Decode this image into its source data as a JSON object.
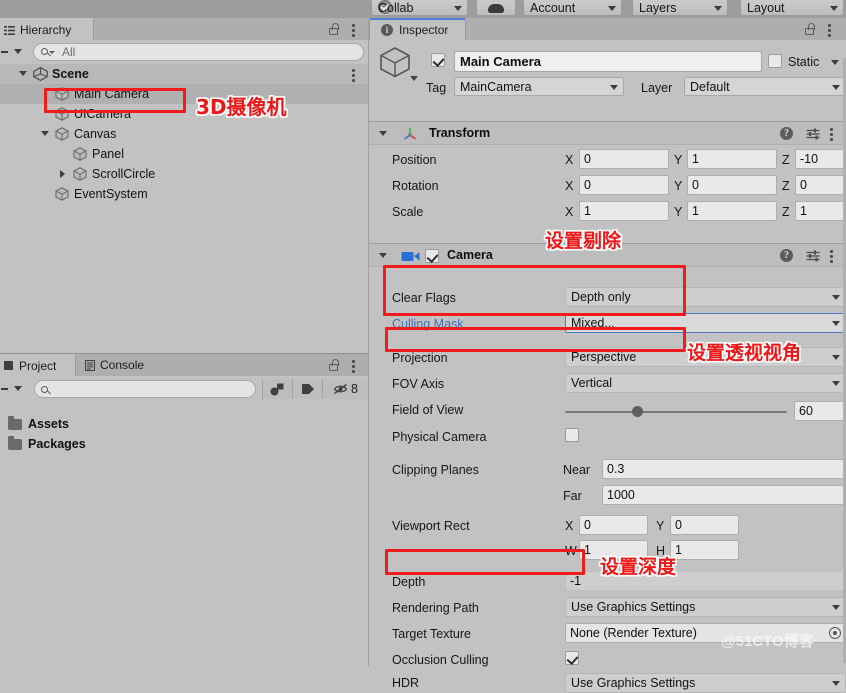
{
  "toolbar": {
    "collab_label": "Collab",
    "cloud_label": "",
    "account_label": "Account",
    "layers_label": "Layers",
    "layout_label": "Layout"
  },
  "hierarchy": {
    "tab_label": "Hierarchy",
    "search_placeholder": "All",
    "items": [
      {
        "label": "Scene",
        "depth": 0,
        "twisty": "open",
        "icon": "unity-scene-icon"
      },
      {
        "label": "Main Camera",
        "depth": 1,
        "twisty": "none",
        "icon": "gameobject-cube-icon"
      },
      {
        "label": "UICamera",
        "depth": 1,
        "twisty": "none",
        "icon": "gameobject-cube-icon"
      },
      {
        "label": "Canvas",
        "depth": 1,
        "twisty": "open",
        "icon": "gameobject-cube-icon"
      },
      {
        "label": "Panel",
        "depth": 2,
        "twisty": "none",
        "icon": "gameobject-cube-icon"
      },
      {
        "label": "ScrollCircle",
        "depth": 2,
        "twisty": "closed",
        "icon": "gameobject-cube-icon"
      },
      {
        "label": "EventSystem",
        "depth": 1,
        "twisty": "none",
        "icon": "gameobject-cube-icon"
      }
    ]
  },
  "project": {
    "tab_label": "Project",
    "console_tab_label": "Console",
    "search_placeholder": "",
    "hidden_count": "8",
    "items": [
      {
        "label": "Assets"
      },
      {
        "label": "Packages"
      }
    ]
  },
  "inspector": {
    "tab_label": "Inspector",
    "object_name": "Main Camera",
    "object_enabled": true,
    "static_label": "Static",
    "static_checked": false,
    "tag_label": "Tag",
    "tag_value": "MainCamera",
    "layer_label": "Layer",
    "layer_value": "Default",
    "transform": {
      "title": "Transform",
      "rows": [
        {
          "label": "Position",
          "x": "0",
          "y": "1",
          "z": "-10"
        },
        {
          "label": "Rotation",
          "x": "0",
          "y": "0",
          "z": "0"
        },
        {
          "label": "Scale",
          "x": "1",
          "y": "1",
          "z": "1"
        }
      ],
      "axis_x": "X",
      "axis_y": "Y",
      "axis_z": "Z"
    },
    "camera": {
      "title": "Camera",
      "enabled": true,
      "clear_flags_label": "Clear Flags",
      "clear_flags_value": "Depth only",
      "culling_mask_label": "Culling Mask",
      "culling_mask_value": "Mixed...",
      "projection_label": "Projection",
      "projection_value": "Perspective",
      "fov_axis_label": "FOV Axis",
      "fov_axis_value": "Vertical",
      "field_of_view_label": "Field of View",
      "field_of_view_value": "60",
      "field_of_view_slider_pct": 30,
      "physical_camera_label": "Physical Camera",
      "physical_camera_checked": false,
      "clipping_planes_label": "Clipping Planes",
      "near_label": "Near",
      "near_value": "0.3",
      "far_label": "Far",
      "far_value": "1000",
      "viewport_rect_label": "Viewport Rect",
      "viewport_x_label": "X",
      "viewport_x_value": "0",
      "viewport_y_label": "Y",
      "viewport_y_value": "0",
      "viewport_w_label": "W",
      "viewport_w_value": "1",
      "viewport_h_label": "H",
      "viewport_h_value": "1",
      "depth_label": "Depth",
      "depth_value": "-1",
      "rendering_path_label": "Rendering Path",
      "rendering_path_value": "Use Graphics Settings",
      "target_texture_label": "Target Texture",
      "target_texture_value": "None (Render Texture)",
      "occlusion_culling_label": "Occlusion Culling",
      "occlusion_culling_checked": true,
      "hdr_label": "HDR",
      "hdr_value": "Use Graphics Settings"
    }
  },
  "annotations": {
    "main_camera": "3D摄像机",
    "culling": "设置剔除",
    "projection": "设置透视视角",
    "depth": "设置深度"
  },
  "watermark": "@51CTO博客",
  "colors": {
    "annotation_red": "#ee1717",
    "panel_bg": "#c2c2c2",
    "tab_accent": "#4b7fd6",
    "link_blue": "#3f6fb5"
  }
}
